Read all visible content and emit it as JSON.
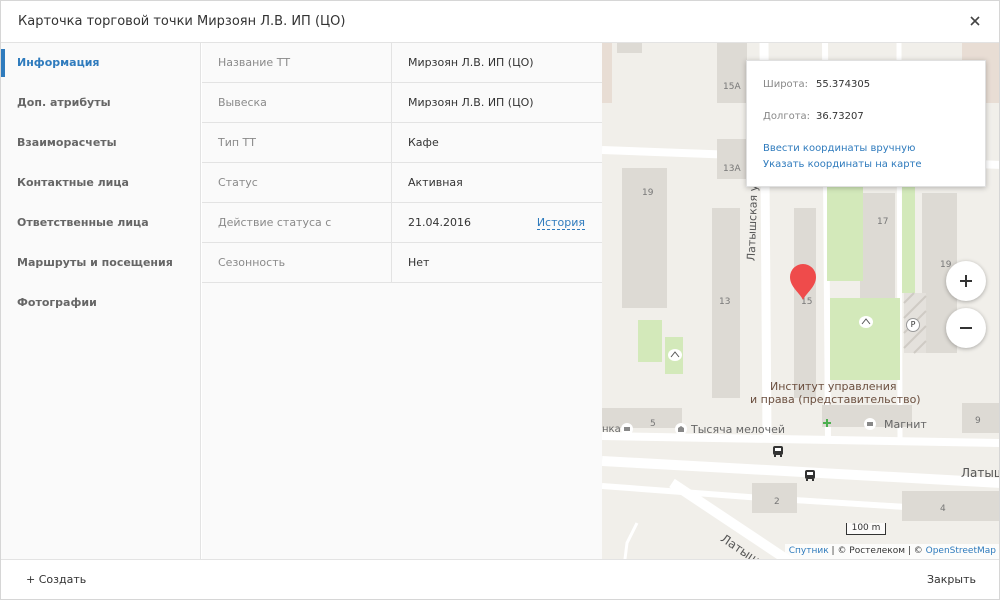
{
  "dialog": {
    "title": "Карточка торговой точки Мирзоян Л.В. ИП (ЦО)"
  },
  "sidebar": {
    "items": [
      {
        "label": "Информация",
        "active": true
      },
      {
        "label": "Доп. атрибуты"
      },
      {
        "label": "Взаиморасчеты"
      },
      {
        "label": "Контактные лица"
      },
      {
        "label": "Ответственные лица"
      },
      {
        "label": "Маршруты и посещения"
      },
      {
        "label": "Фотографии"
      }
    ]
  },
  "info": {
    "rows": [
      {
        "label": "Название ТТ",
        "value": "Мирзоян Л.В. ИП (ЦО)"
      },
      {
        "label": "Вывеска",
        "value": "Мирзоян Л.В. ИП (ЦО)"
      },
      {
        "label": "Тип ТТ",
        "value": "Кафе"
      },
      {
        "label": "Статус",
        "value": "Активная"
      },
      {
        "label": "Действие статуса с",
        "value": "21.04.2016",
        "link": "История"
      },
      {
        "label": "Сезонность",
        "value": "Нет"
      }
    ]
  },
  "map": {
    "coords": {
      "lat_label": "Широта:",
      "lat_value": "55.374305",
      "lon_label": "Долгота:",
      "lon_value": "36.73207",
      "link_manual": "Ввести координаты вручную",
      "link_on_map": "Указать координаты на карте"
    },
    "labels": {
      "house_15a": "15А",
      "house_13a": "13А",
      "house_19_left": "19",
      "house_17": "17",
      "house_19_right": "19",
      "house_13": "13",
      "house_15": "15",
      "house_5": "5",
      "house_9": "9",
      "house_2": "2",
      "house_4": "4",
      "street_vertical": "Латышская ул",
      "street_right": "Латыш",
      "street_bottom": "Латышск",
      "institute_1": "Институт управления",
      "institute_2": "и права (представительство)",
      "shop_left": "нка",
      "shop_1000": "Тысяча мелочей",
      "shop_magnit": "Магнит",
      "parking": "P"
    },
    "scale": "100 m",
    "attribution": {
      "sputnik": "Спутник",
      "sep1": " | © Ростелеком | © ",
      "osm": "OpenStreetMap"
    },
    "marker_color": "#ef4b4b"
  },
  "footer": {
    "create_label": "+ Создать",
    "close_label": "Закрыть"
  }
}
